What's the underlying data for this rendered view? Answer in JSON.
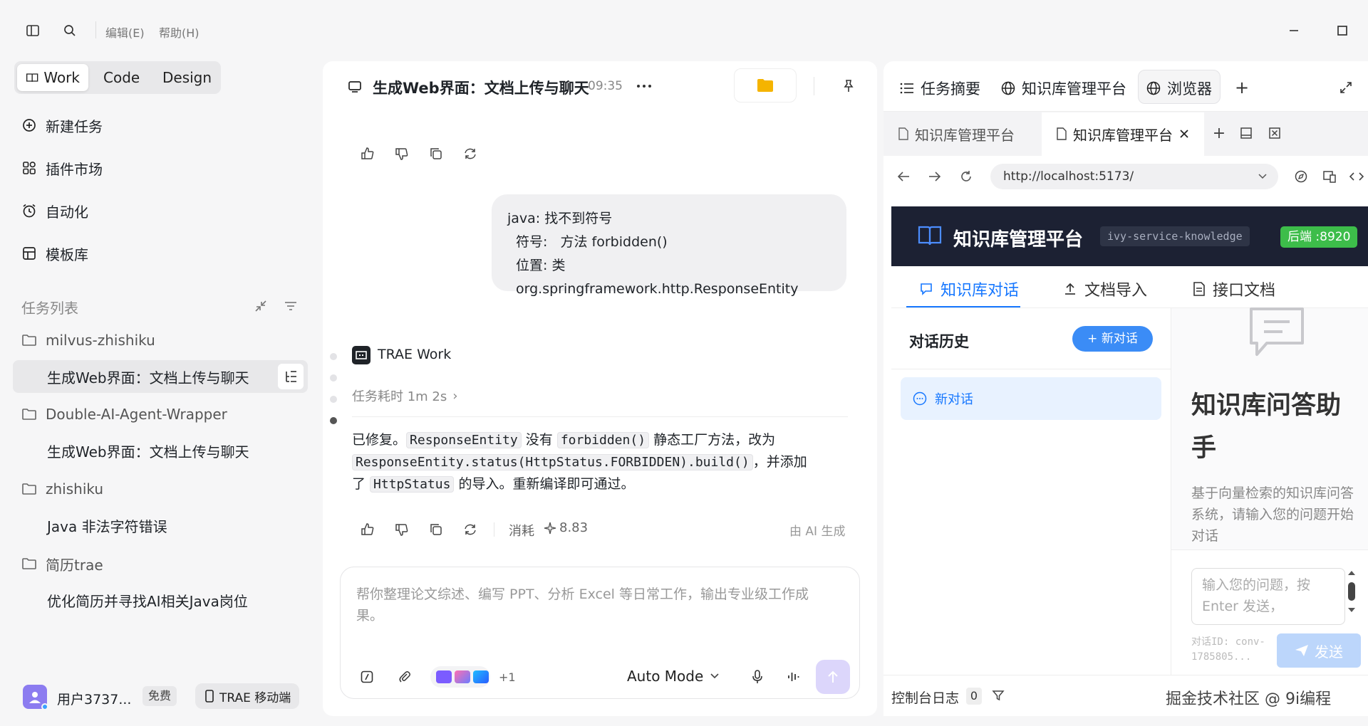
{
  "titlebar": {
    "menu_edit": "编辑(E)",
    "menu_help": "帮助(H)"
  },
  "modes": {
    "items": [
      "Work",
      "Code",
      "Design"
    ],
    "active": "Work"
  },
  "nav": {
    "new_task": "新建任务",
    "plugins": "插件市场",
    "automation": "自动化",
    "templates": "模板库"
  },
  "task_list": {
    "title": "任务列表",
    "groups": [
      {
        "folder": "milvus-zhishiku",
        "tasks": [
          "生成Web界面：文档上传与聊天"
        ]
      },
      {
        "folder": "Double-AI-Agent-Wrapper",
        "tasks": [
          "生成Web界面：文档上传与聊天"
        ]
      },
      {
        "folder": "zhishiku",
        "tasks": [
          "Java 非法字符错误"
        ]
      },
      {
        "folder": "简历trae",
        "tasks": [
          "优化简历并寻找AI相关Java岗位"
        ]
      }
    ]
  },
  "user": {
    "name": "用户3737...",
    "plan": "免费",
    "mobile": "TRAE 移动端"
  },
  "chat": {
    "title": "生成Web界面：文档上传与聊天",
    "time": "09:35",
    "user_message": [
      "java: 找不到符号",
      "符号:   方法 forbidden()",
      "位置: 类 org.springframework.http.ResponseEntity"
    ],
    "assistant_name": "TRAE Work",
    "duration": "任务耗时 1m 2s",
    "reply": {
      "t1": "已修复。",
      "c1": "ResponseEntity",
      "t2": " 没有 ",
      "c2": "forbidden()",
      "t3": " 静态工厂方法，改为",
      "c3": "ResponseEntity.status(HttpStatus.FORBIDDEN).build()",
      "t4": "，并添加",
      "t5": "了 ",
      "c4": "HttpStatus",
      "t6": " 的导入。重新编译即可通过。"
    },
    "cost_label": "消耗",
    "cost_value": "8.83",
    "ai_note": "由 AI 生成",
    "input_placeholder": "帮你整理论文综述、编写 PPT、分析 Excel 等日常工作，输出专业级工作成果。",
    "plus_count": "+1",
    "mode": "Auto Mode"
  },
  "right": {
    "tabs": [
      "任务摘要",
      "知识库管理平台",
      "浏览器"
    ],
    "browser_tabs": [
      "知识库管理平台",
      "知识库管理平台"
    ],
    "url": "http://localhost:5173/",
    "console_label": "控制台日志",
    "console_count": "0",
    "watermark": "掘金技术社区 @ 9i编程"
  },
  "kb": {
    "title": "知识库管理平台",
    "service": "ivy-service-knowledge",
    "backend": "后端 :8920",
    "tabs": [
      "知识库对话",
      "文档导入",
      "接口文档"
    ],
    "history_title": "对话历史",
    "new_chat_btn": "+ 新对话",
    "new_chat_item": "新对话",
    "assistant_title": "知识库问答助手",
    "assistant_desc": "基于向量检索的知识库问答系统，请输入您的问题开始对话",
    "input_placeholder": "输入您的问题，按 Enter 发送，",
    "conv_id": "对话ID: conv-1785805...",
    "send": "发送"
  },
  "colors": {
    "accent_blue": "#1677ff",
    "kb_header_bg": "#1c2133",
    "backend_green": "#3dbd4a",
    "send_disabled": "#bcd6fb"
  }
}
